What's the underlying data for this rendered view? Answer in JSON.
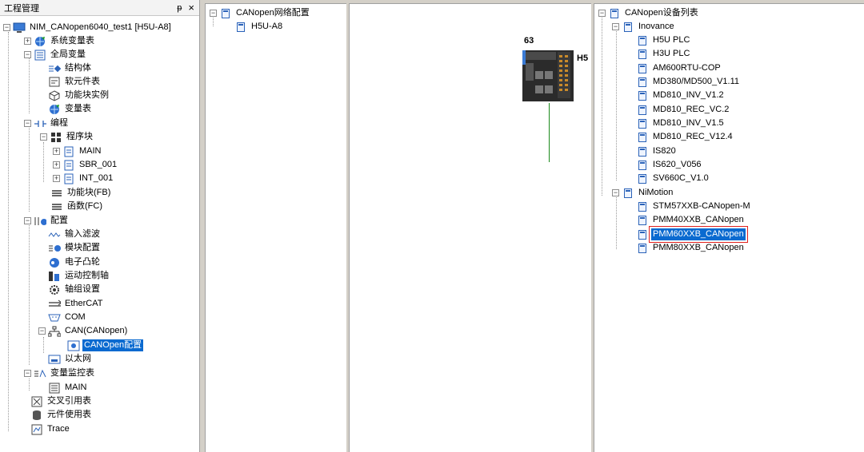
{
  "left_panel": {
    "title": "工程管理",
    "pin_label": "ᵽ",
    "close_label": "×",
    "tree": [
      {
        "label": "NIM_CANopen6040_test1 [H5U-A8]",
        "icon": "computer-icon"
      },
      {
        "label": "系统变量表",
        "icon": "globe-icon"
      },
      {
        "label": "全局变量",
        "icon": "table-icon"
      },
      {
        "label": "结构体",
        "icon": "struct-icon"
      },
      {
        "label": "软元件表",
        "icon": "component-icon"
      },
      {
        "label": "功能块实例",
        "icon": "cube-icon"
      },
      {
        "label": "变量表",
        "icon": "globe-icon"
      },
      {
        "label": "编程",
        "icon": "ladder-icon"
      },
      {
        "label": "程序块",
        "icon": "blocks-icon"
      },
      {
        "label": "MAIN",
        "icon": "doc-icon"
      },
      {
        "label": "SBR_001",
        "icon": "doc-icon"
      },
      {
        "label": "INT_001",
        "icon": "doc-icon"
      },
      {
        "label": "功能块(FB)",
        "icon": "fb-icon"
      },
      {
        "label": "函数(FC)",
        "icon": "fc-icon"
      },
      {
        "label": "配置",
        "icon": "config-icon"
      },
      {
        "label": "输入滤波",
        "icon": "wave-icon"
      },
      {
        "label": "模块配置",
        "icon": "module-icon"
      },
      {
        "label": "电子凸轮",
        "icon": "cam-icon"
      },
      {
        "label": "运动控制轴",
        "icon": "axis-icon"
      },
      {
        "label": "轴组设置",
        "icon": "gear-icon"
      },
      {
        "label": "EtherCAT",
        "icon": "ethercat-icon"
      },
      {
        "label": "COM",
        "icon": "com-icon"
      },
      {
        "label": "CAN(CANopen)",
        "icon": "network-icon"
      },
      {
        "label": "CANOpen配置",
        "icon": "canopen-config-icon"
      },
      {
        "label": "以太网",
        "icon": "ethernet-icon"
      },
      {
        "label": "变量监控表",
        "icon": "monitor-icon"
      },
      {
        "label": "MAIN",
        "icon": "doc-icon"
      },
      {
        "label": "交叉引用表",
        "icon": "crossref-icon"
      },
      {
        "label": "元件使用表",
        "icon": "database-icon"
      },
      {
        "label": "Trace",
        "icon": "trace-icon"
      }
    ]
  },
  "network_panel": {
    "root": "CANopen网络配置",
    "child": "H5U-A8"
  },
  "canvas": {
    "node_id": "63",
    "device_label": "H5"
  },
  "device_panel": {
    "root": "CANopen设备列表",
    "groups": [
      {
        "name": "Inovance",
        "items": [
          "H5U PLC",
          "H3U PLC",
          "AM600RTU-COP",
          "MD380/MD500_V1.11",
          "MD810_INV_V1.2",
          "MD810_REC_VC.2",
          "MD810_INV_V1.5",
          "MD810_REC_V12.4",
          "IS820",
          "IS620_V056",
          "SV660C_V1.0"
        ]
      },
      {
        "name": "NiMotion",
        "items": [
          "STM57XXB-CANopen-M",
          "PMM40XXB_CANopen",
          "PMM60XXB_CANopen",
          "PMM80XXB_CANopen"
        ]
      }
    ],
    "selected": "PMM60XXB_CANopen"
  },
  "colors": {
    "selection": "#0a6ad0",
    "highlight_box": "#e0201c",
    "bus_line": "#1a8a1a"
  }
}
